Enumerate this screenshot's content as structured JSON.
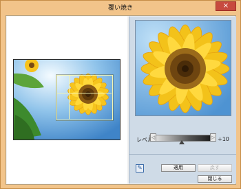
{
  "window": {
    "title": "覆い焼き",
    "close_icon": "×",
    "colors": {
      "frame": "#f2c48a",
      "close_button": "#c74a3f",
      "right_panel": "#cfdbe7"
    }
  },
  "source_image": {
    "icon": "sunflower-photo"
  },
  "preview": {
    "icon": "sunflower-closeup-photo"
  },
  "level": {
    "label": "レベル",
    "value_text": "+10",
    "left_arrow": "◁",
    "right_arrow": "▷",
    "value": 10
  },
  "tools": {
    "picker_icon": "✎"
  },
  "buttons": {
    "apply": "適用",
    "undo": "戻す",
    "close": "閉じる"
  }
}
